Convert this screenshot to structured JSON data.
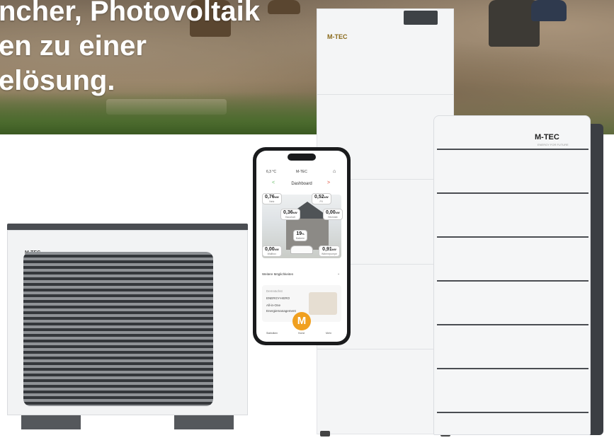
{
  "headline": [
    "ncher, Photovoltaik",
    "en zu einer",
    "elösung."
  ],
  "brand": {
    "logo": "M-TEC",
    "tagline": "ENERGY FOR FUTURE",
    "accent": "#e08a12"
  },
  "phone": {
    "temperature": "6,3 °C",
    "app_name": "M-TEC",
    "screen_title": "Dashboard",
    "readings": [
      {
        "value": "0,76",
        "unit": "kW",
        "label": "Netz"
      },
      {
        "value": "0,52",
        "unit": "kW",
        "label": "PV"
      },
      {
        "value": "0,36",
        "unit": "kW",
        "label": "Haushalt"
      },
      {
        "value": "0,00",
        "unit": "kW",
        "label": "Heizstab"
      },
      {
        "value": "19",
        "unit": "%",
        "label": "Batterie"
      },
      {
        "value": "0,00",
        "unit": "kW",
        "label": "Wallbox"
      },
      {
        "value": "0,91",
        "unit": "kW",
        "label": "Wärmepumpe"
      }
    ],
    "more_label": "Weitere Möglichkeiten",
    "card": {
      "kicker": "Demnächst",
      "title": "ENERGY-HERO",
      "line1": "All-in-One",
      "line2": "Energiemanagement"
    },
    "center_button": "M",
    "nav": [
      "Statistiken",
      "Home",
      "Mehr"
    ]
  }
}
